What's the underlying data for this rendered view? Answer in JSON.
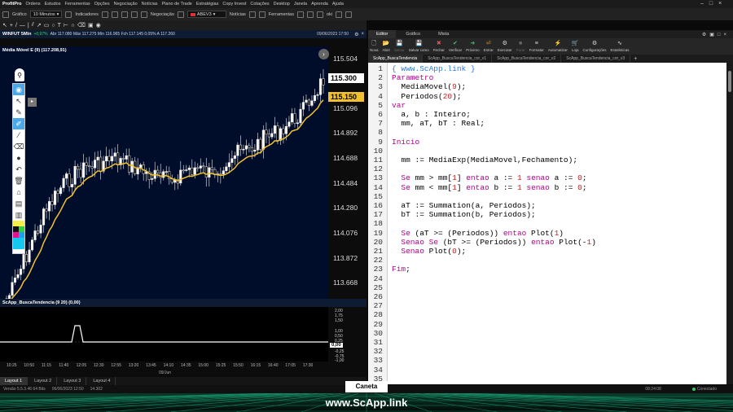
{
  "menubar": {
    "app": "ProfitPro",
    "items": [
      "Ordens",
      "Estudos",
      "Ferramentas",
      "Opções",
      "Negociação",
      "Notícias",
      "Plano de Trade",
      "Estratégias",
      "Copy Invest",
      "Cotações",
      "Desktop",
      "Janela",
      "Aprenda",
      "Ajuda"
    ]
  },
  "toolbar": {
    "chart_label": "Gráfico",
    "interval": "10 Minutos",
    "indicators_label": "Indicadores",
    "trade_label": "Negociação",
    "asset": "ABEV3",
    "news_label": "Notícias",
    "tools_label": "Ferramentas",
    "oki": "oki"
  },
  "chart": {
    "header": "WINFUT 5Min",
    "change": "+0,97%",
    "ohlc": "Abr 117.080 Máx 117.275 Mín 116.965 Fch 117.145 0.05% A 117.260",
    "datetime": "09/06/2023 17:50",
    "indicator_label": "Média Móvel E (9) (117.208,91)",
    "price_levels": [
      "115.504",
      "115.300",
      "115.150",
      "115.096",
      "114.892",
      "114.688",
      "114.484",
      "114.280",
      "114.076",
      "113.872",
      "113.668"
    ],
    "last_price": "115.300",
    "ma_price": "115.150",
    "osc_label": "ScApp_BuscaTendencia (9 20) (0,00)",
    "osc_levels": [
      "2,00",
      "1,75",
      "1,50",
      "1,00",
      "0,50",
      "0,25",
      "0,00",
      "-0,25",
      "-0,75",
      "-1,00"
    ],
    "osc_value": "0,00",
    "time_labels": [
      "10:25",
      "10:50",
      "11:15",
      "11:40",
      "12:05",
      "12:30",
      "12:55",
      "13:20",
      "13:45",
      "14:10",
      "14:35",
      "15:00",
      "15:25",
      "15:50",
      "16:15",
      "16:40",
      "17:05",
      "17:30"
    ],
    "date_label": "09/Jun",
    "colors": {
      "ma": "#f2c12e",
      "candle_bull": "#ffffff",
      "candle_bear": "#000000",
      "wick": "#cfcfcf",
      "bg": "#000d2a",
      "last_price_bg": "#ffffff",
      "ma_price_bg": "#f2c12e"
    }
  },
  "layouts": [
    "Layout 1",
    "Layout 2",
    "Layout 3",
    "Layout 4"
  ],
  "editor": {
    "tabs": [
      "Editor",
      "Gráfico",
      "Mista"
    ],
    "ribbon": [
      {
        "label": "Nova",
        "icon": "new-icon"
      },
      {
        "label": "Abrir",
        "icon": "open-icon"
      },
      {
        "label": "Salvar",
        "icon": "save-icon",
        "disabled": true
      },
      {
        "label": "Salvar como",
        "icon": "save-as-icon"
      },
      {
        "label": "Fechar",
        "icon": "close-icon"
      },
      {
        "label": "Verificar",
        "icon": "check-icon"
      },
      {
        "label": "Próximo",
        "icon": "next-icon"
      },
      {
        "label": "Entrar",
        "icon": "enter-icon"
      },
      {
        "label": "Executar",
        "icon": "run-icon"
      },
      {
        "label": "Parar",
        "icon": "stop-icon",
        "disabled": true
      },
      {
        "label": "Formatar",
        "icon": "format-icon"
      },
      {
        "label": "Automatizar",
        "icon": "automate-icon"
      },
      {
        "label": "Loja",
        "icon": "store-icon"
      },
      {
        "label": "Configurações",
        "icon": "settings-icon"
      },
      {
        "label": "Estatísticas",
        "icon": "stats-icon"
      }
    ],
    "files": [
      "ScApp_BuscaTendencia",
      "ScApp_BuscaTendencia_cor_v1",
      "ScApp_BuscaTendencia_cor_v2",
      "ScApp_BuscaTendencia_cor_v3"
    ],
    "code": [
      "{ www.ScApp.link }",
      "Parametro",
      "  MediaMovel(9);",
      "  Periodos(20);",
      "var",
      "  a, b : Inteiro;",
      "  mm, aT, bT : Real;",
      "",
      "Inicio",
      "",
      "  mm := MediaExp(MediaMovel,Fechamento);",
      "",
      "  Se mm > mm[1] entao a := 1 senao a := 0;",
      "  Se mm < mm[1] entao b := 1 senao b := 0;",
      "",
      "  aT := Summation(a, Periodos);",
      "  bT := Summation(b, Periodos);",
      "",
      "  Se (aT >= (Periodos)) entao Plot(1)",
      "  Senao Se (bT >= (Periodos)) entao Plot(-1)",
      "  Senao Plot(0);",
      "",
      "Fim;",
      "",
      "",
      "",
      "",
      "",
      "",
      "",
      "",
      "",
      "",
      "",
      ""
    ]
  },
  "status": {
    "version": "Versão 5.5.3.46 64 Bits",
    "datetime": "06/06/2023 12:50",
    "ping": "14.302",
    "clock": "08:24:08",
    "connection": "Conectado"
  },
  "caneta": "Caneta",
  "footer_text": "www.ScApp.link"
}
